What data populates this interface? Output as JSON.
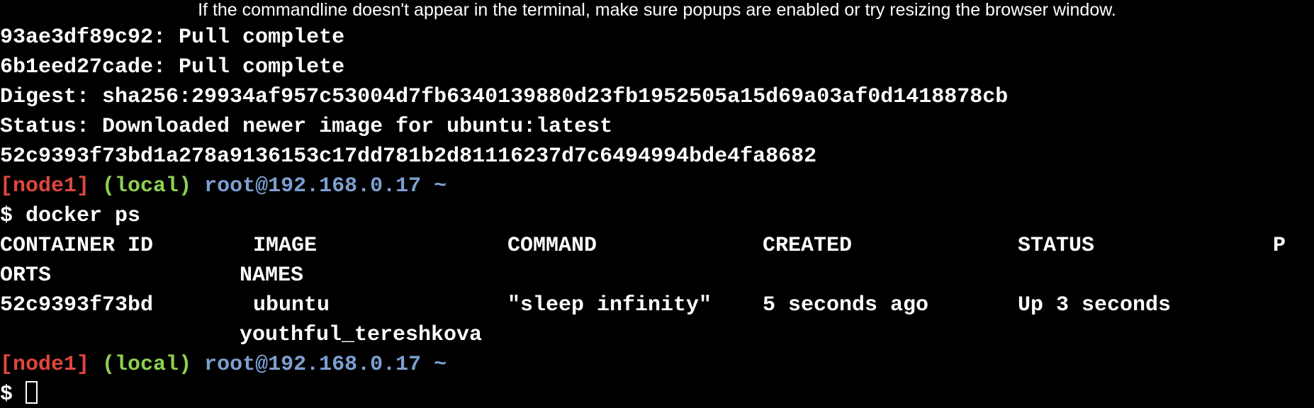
{
  "banner": {
    "text": "If the commandline doesn't appear in the terminal, make sure popups are enabled or try resizing the browser window."
  },
  "output_lines": {
    "pull1": "93ae3df89c92: Pull complete",
    "pull2": "6b1eed27cade: Pull complete",
    "digest": "Digest: sha256:29934af957c53004d7fb6340139880d23fb1952505a15d69a03af0d1418878cb",
    "status": "Status: Downloaded newer image for ubuntu:latest",
    "container_hash": "52c9393f73bd1a278a9136153c17dd781b2d81116237d7c6494994bde4fa8682"
  },
  "prompt": {
    "node": "[node1]",
    "local": "(local)",
    "host": "root@192.168.0.17",
    "tilde": "~",
    "dollar": "$ "
  },
  "command": "docker ps",
  "table": {
    "headers": {
      "container_id": "CONTAINER ID",
      "image": "IMAGE",
      "command": "COMMAND",
      "created": "CREATED",
      "status": "STATUS",
      "ports_start": "P",
      "ports_end": "ORTS",
      "names": "NAMES"
    },
    "rows": [
      {
        "container_id": "52c9393f73bd",
        "image": "ubuntu",
        "command": "\"sleep infinity\"",
        "created": "5 seconds ago",
        "status": "Up 3 seconds",
        "names": "youthful_tereshkova"
      }
    ]
  },
  "colors": {
    "background": "#000000",
    "text": "#ffffff",
    "node": "#e0463f",
    "local": "#8fd14f",
    "host": "#7d9fd1"
  }
}
